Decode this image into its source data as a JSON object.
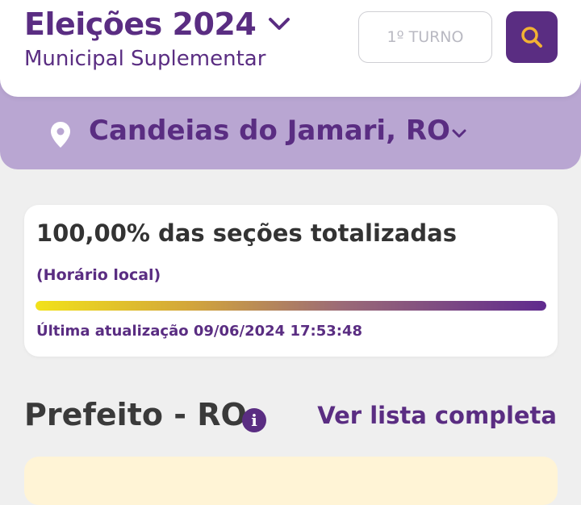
{
  "header": {
    "title": "Eleições 2024",
    "subtitle": "Municipal Suplementar",
    "turno_label": "1º TURNO"
  },
  "location": {
    "name": "Candeias do Jamari, RO"
  },
  "status": {
    "totalized_text": "100,00% das seções totalizadas",
    "local_time_note": "(Horário local)",
    "progress_fraction": 1.0,
    "last_update": "Última atualização 09/06/2024 17:53:48"
  },
  "section": {
    "title": "Prefeito - RO",
    "see_list_label": "Ver lista completa"
  },
  "icons": {
    "title_chevron": "chevron-down-icon",
    "search": "search-icon",
    "location": "location-pin-icon",
    "info": "info-icon"
  },
  "colors": {
    "primary": "#5a2d82",
    "band": "#b9a6d2",
    "search_glass": "#f2b233",
    "progress_start": "#f2e21a",
    "progress_end": "#5f2a8e"
  }
}
